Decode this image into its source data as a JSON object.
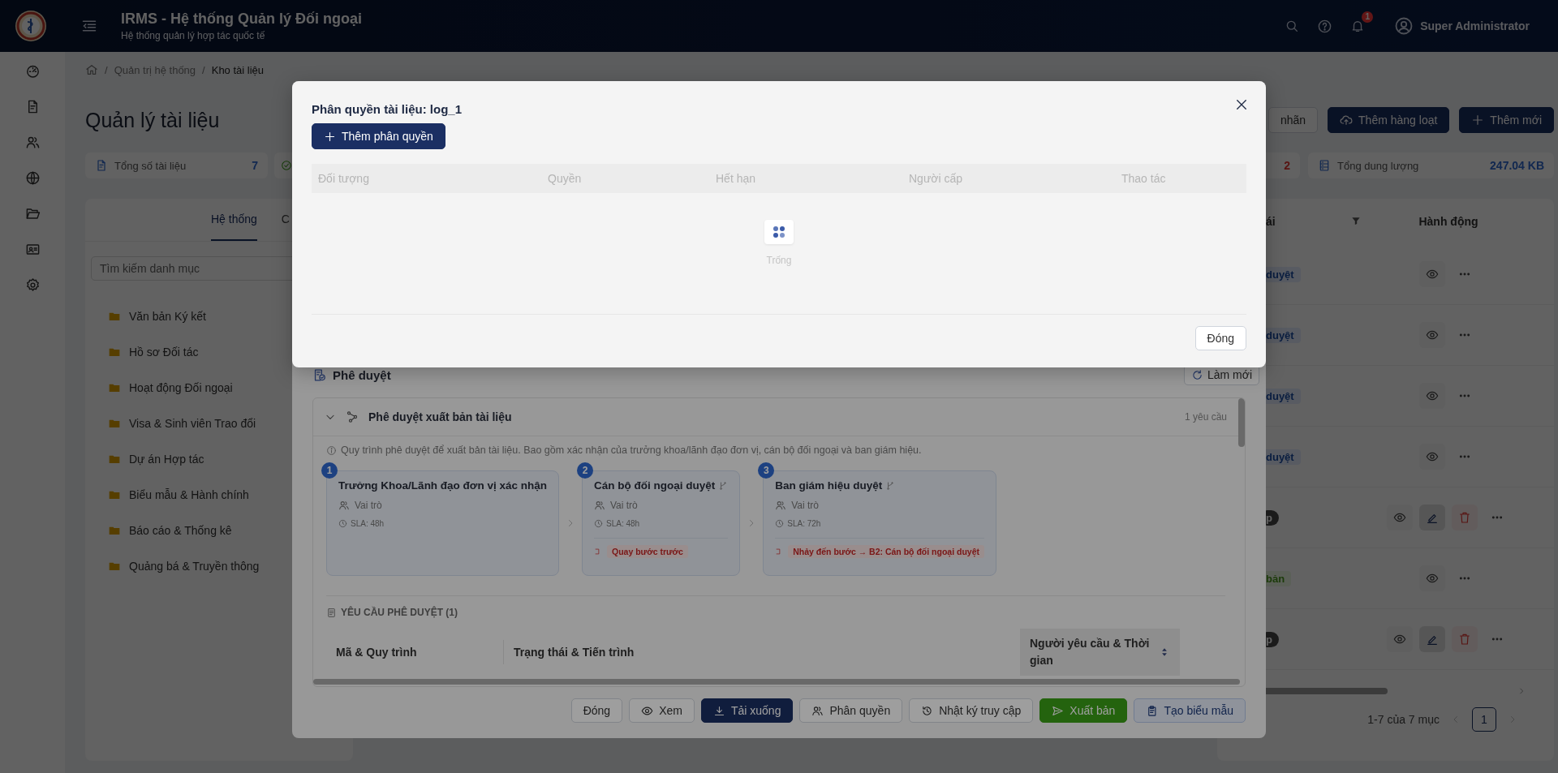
{
  "header": {
    "title": "IRMS - Hệ thống Quản lý Đối ngoại",
    "subtitle": "Hệ thống quản lý hợp tác quốc tế",
    "notification_count": "1",
    "user_name": "Super Administrator"
  },
  "breadcrumb": [
    {
      "label": "Quản trị hệ thống"
    },
    {
      "label": "Kho tài liệu"
    }
  ],
  "breadcrumb_separator": "/",
  "page_title": "Quản lý tài liệu",
  "toolbar_buttons": [
    {
      "label": "nhãn",
      "kind": "outline"
    },
    {
      "label": "Thêm hàng loạt",
      "kind": "upload"
    },
    {
      "label": "Thêm mới",
      "kind": "add"
    }
  ],
  "stats": [
    {
      "kind": "total",
      "label": "Tổng số tài liệu",
      "value": "7"
    },
    {
      "kind": "approved"
    },
    {
      "kind": "rejected",
      "value": "2"
    },
    {
      "kind": "size",
      "label": "Tổng dung lượng",
      "value": "247.04 KB"
    }
  ],
  "category_panel": {
    "tabs": [
      {
        "label": "Hệ thống",
        "selected": true
      },
      {
        "label": "C",
        "selected": false
      }
    ],
    "search_placeholder": "Tìm kiếm danh mục",
    "folders": [
      {
        "name": "Văn bản Ký kết"
      },
      {
        "name": "Hồ sơ Đối tác"
      },
      {
        "name": "Hoạt động Đối ngoại"
      },
      {
        "name": "Visa & Sinh viên Trao đổi"
      },
      {
        "name": "Dự án Hợp tác"
      },
      {
        "name": "Biểu mẫu & Hành chính"
      },
      {
        "name": "Báo cáo & Thống kê"
      },
      {
        "name": "Quảng bá & Truyền thông"
      }
    ]
  },
  "documents_table": {
    "columns": [
      "ái",
      "Hành động"
    ],
    "rows": [
      {
        "status": "duyệt",
        "kind": "pending",
        "editable": false
      },
      {
        "status": "duyệt",
        "kind": "pending",
        "editable": false
      },
      {
        "status": "duyệt",
        "kind": "pending",
        "editable": false
      },
      {
        "status": "duyệt",
        "kind": "pending",
        "editable": false
      },
      {
        "status": "p",
        "kind": "draft",
        "editable": true
      },
      {
        "status": "bản",
        "kind": "published",
        "editable": false
      },
      {
        "status": "p",
        "kind": "draft",
        "editable": true
      }
    ],
    "pagination": {
      "summary": "1-7 của 7 mục",
      "pages": [
        {
          "label": "1",
          "selected": true
        }
      ]
    }
  },
  "detail_dialog": {
    "section_title": "Phê duyệt",
    "refresh_label": "Làm mới",
    "workflow": {
      "title": "Phê duyệt xuất bản tài liệu",
      "expanded": true,
      "request_count": "1 yêu cầu",
      "description": "Quy trình phê duyệt để xuất bản tài liệu. Bao gồm xác nhận của trưởng khoa/lãnh đạo đơn vị, cán bộ đối ngoại và ban giám hiệu.",
      "steps": [
        {
          "number": "1",
          "title": "Trưởng Khoa/Lãnh đạo đơn vị xác nhận",
          "branching": false,
          "assignee": "Vai trò",
          "sla": "SLA: 48h"
        },
        {
          "number": "2",
          "title": "Cán bộ đối ngoại duyệt",
          "branching": true,
          "assignee": "Vai trò",
          "sla": "SLA: 48h",
          "reject_action": "Quay bước trước"
        },
        {
          "number": "3",
          "title": "Ban giám hiệu duyệt",
          "branching": true,
          "assignee": "Vai trò",
          "sla": "SLA: 72h",
          "reject_action": "Nhảy đến bước → B2: Cán bộ đối ngoại duyệt"
        }
      ]
    },
    "requests": {
      "title": "YÊU CẦU PHÊ DUYỆT (1)",
      "columns": [
        {
          "label": "Mã & Quy trình",
          "sorted": false
        },
        {
          "label": "Trạng thái & Tiến trình",
          "sorted": false
        },
        {
          "label": "Người yêu cầu & Thời gian",
          "sorted": true
        }
      ]
    },
    "footer_buttons": [
      {
        "label": "Đóng",
        "kind": "default"
      },
      {
        "label": "Xem",
        "kind": "view"
      },
      {
        "label": "Tải xuống",
        "kind": "download"
      },
      {
        "label": "Phân quyền",
        "kind": "permissions"
      },
      {
        "label": "Nhật ký truy cập",
        "kind": "history"
      },
      {
        "label": "Xuất bản",
        "kind": "publish"
      },
      {
        "label": "Tạo biểu mẫu",
        "kind": "template"
      }
    ]
  },
  "permission_dialog": {
    "title": "Phân quyền tài liệu: log_1",
    "add_button": "Thêm phân quyền",
    "columns": [
      "Đối tượng",
      "Quyền",
      "Hết hạn",
      "Người cấp",
      "Thao tác"
    ],
    "loading": true,
    "empty_text": "Trống",
    "close_button": "Đóng"
  }
}
